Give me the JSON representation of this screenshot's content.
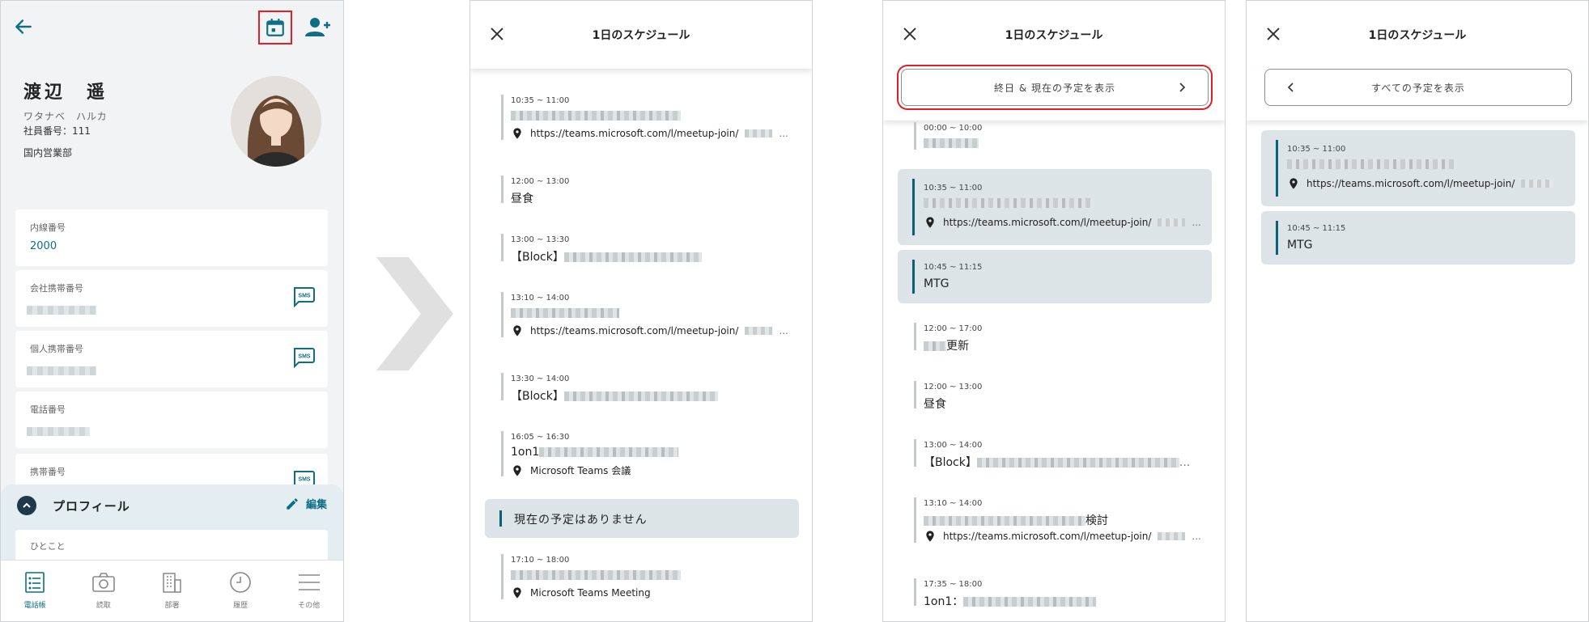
{
  "colors": {
    "accent": "#0d6e86",
    "highlight_box": "#e21f26",
    "selected_event_bg": "#dde4e8",
    "selected_event_bar": "#0d5f77"
  },
  "profile_screen": {
    "icons": [
      "back-arrow-icon",
      "calendar-icon",
      "add-user-icon"
    ],
    "name": "渡辺　遥",
    "kana": "ワタナベ　ハルカ",
    "employee_no": "社員番号：111",
    "department": "国内営業部",
    "fields": [
      {
        "label": "内線番号",
        "value": "2000"
      },
      {
        "label": "会社携帯番号",
        "sms": "SMS"
      },
      {
        "label": "個人携帯番号",
        "sms": "SMS"
      },
      {
        "label": "電話番号"
      },
      {
        "label": "携帯番号",
        "sms": "SMS"
      }
    ],
    "sheet": {
      "title": "プロフィール",
      "edit_label": "編集",
      "hitokoto_label": "ひとこと"
    },
    "nav": [
      {
        "label": "電話帳",
        "icon": "phonebook-icon"
      },
      {
        "label": "読取",
        "icon": "camera-icon"
      },
      {
        "label": "部署",
        "icon": "building-icon"
      },
      {
        "label": "履歴",
        "icon": "clock-icon"
      },
      {
        "label": "その他",
        "icon": "menu-icon"
      }
    ]
  },
  "schedule_full": {
    "title": "1日のスケジュール",
    "events": [
      {
        "time": "10:35 ~ 11:00",
        "location": "https://teams.microsoft.com/l/meetup-join/",
        "ellipsis": "..."
      },
      {
        "time": "12:00 ~ 13:00",
        "title": "昼食"
      },
      {
        "time": "13:00 ~ 13:30",
        "title_prefix": "【Block】"
      },
      {
        "time": "13:10 ~ 14:00",
        "location": "https://teams.microsoft.com/l/meetup-join/",
        "ellipsis": "..."
      },
      {
        "time": "13:30 ~ 14:00",
        "title_prefix": "【Block】"
      },
      {
        "time": "16:05 ~ 16:30",
        "title_prefix": "1on1",
        "location": "Microsoft Teams 会議"
      },
      {
        "time": "17:10 ~ 18:00",
        "location": "Microsoft Teams Meeting"
      }
    ],
    "no_event": "現在の予定はありません"
  },
  "schedule_filter": {
    "title": "1日のスケジュール",
    "filter_label": "終日 & 現在の予定を表示",
    "events": [
      {
        "time": "00:00 ~ 10:00"
      },
      {
        "time": "10:35 ~ 11:00",
        "location": "https://teams.microsoft.com/l/meetup-join/",
        "ellipsis": "..."
      },
      {
        "time": "10:45 ~ 11:15",
        "title": "MTG"
      },
      {
        "time": "12:00 ~ 17:00",
        "title_suffix": "更新"
      },
      {
        "time": "12:00 ~ 13:00",
        "title": "昼食"
      },
      {
        "time": "13:00 ~ 14:00",
        "title_prefix": "【Block】",
        "ellipsis": "..."
      },
      {
        "time": "13:10 ~ 14:00",
        "title_suffix": "検討",
        "location": "https://teams.microsoft.com/l/meetup-join/",
        "ellipsis": "..."
      },
      {
        "time": "17:35 ~ 18:00",
        "title_prefix": "1on1："
      }
    ]
  },
  "schedule_current": {
    "title": "1日のスケジュール",
    "filter_label": "すべての予定を表示",
    "events": [
      {
        "time": "10:35 ~ 11:00",
        "location": "https://teams.microsoft.com/l/meetup-join/"
      },
      {
        "time": "10:45 ~ 11:15",
        "title": "MTG"
      }
    ]
  }
}
